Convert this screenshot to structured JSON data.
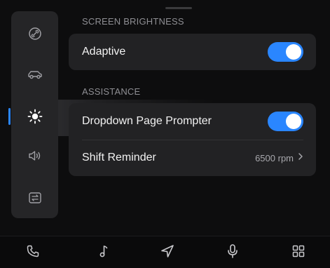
{
  "sidebar": {
    "items": [
      {
        "icon": "link-icon",
        "active": false
      },
      {
        "icon": "car-icon",
        "active": false
      },
      {
        "icon": "sun-icon",
        "active": true
      },
      {
        "icon": "volume-icon",
        "active": false
      },
      {
        "icon": "transfer-icon",
        "active": false
      }
    ]
  },
  "sections": {
    "brightness": {
      "title": "SCREEN BRIGHTNESS",
      "rows": {
        "adaptive": {
          "label": "Adaptive",
          "toggle": "on"
        }
      }
    },
    "assistance": {
      "title": "ASSISTANCE",
      "rows": {
        "prompter": {
          "label": "Dropdown Page Prompter",
          "toggle": "on"
        },
        "shift": {
          "label": "Shift Reminder",
          "value": "6500 rpm"
        }
      }
    }
  },
  "bottom_nav": {
    "items": [
      "phone-icon",
      "music-icon",
      "navigation-icon",
      "microphone-icon",
      "apps-grid-icon"
    ]
  },
  "colors": {
    "accent": "#2a86ff",
    "background": "#0d0d0e",
    "card": "#222224",
    "sidebar": "#252527",
    "muted_text": "#8e8e93"
  }
}
